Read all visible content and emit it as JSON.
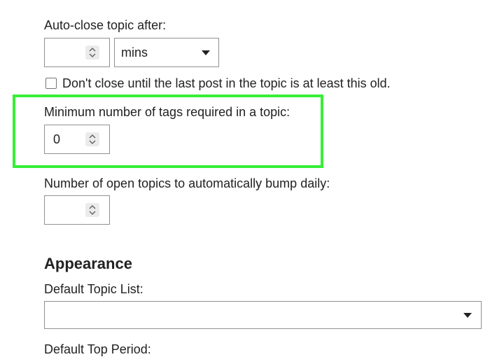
{
  "auto_close": {
    "label": "Auto-close topic after:",
    "value": "",
    "unit_selected": "mins"
  },
  "dont_close": {
    "label": "Don't close until the last post in the topic is at least this old.",
    "checked": false
  },
  "min_tags": {
    "label": "Minimum number of tags required in a topic:",
    "value": "0"
  },
  "bump_daily": {
    "label": "Number of open topics to automatically bump daily:",
    "value": ""
  },
  "appearance": {
    "heading": "Appearance",
    "default_topic_list_label": "Default Topic List:",
    "default_topic_list_value": "",
    "default_top_period_label": "Default Top Period:"
  },
  "colors": {
    "highlight": "#37ee37",
    "border": "#919191",
    "text": "#222222"
  }
}
